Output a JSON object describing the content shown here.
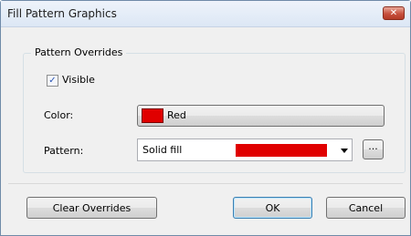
{
  "window": {
    "title": "Fill Pattern Graphics",
    "close_glyph": "✕"
  },
  "group": {
    "legend": "Pattern Overrides",
    "visible": {
      "label": "Visible",
      "checked": true,
      "check_glyph": "✓"
    },
    "color": {
      "label": "Color:",
      "value": "Red",
      "swatch_color": "#e00000"
    },
    "pattern": {
      "label": "Pattern:",
      "value": "Solid fill",
      "preview_color": "#e00000",
      "ellipsis_label": "..."
    }
  },
  "buttons": {
    "clear_overrides": "Clear Overrides",
    "ok": "OK",
    "cancel": "Cancel"
  }
}
